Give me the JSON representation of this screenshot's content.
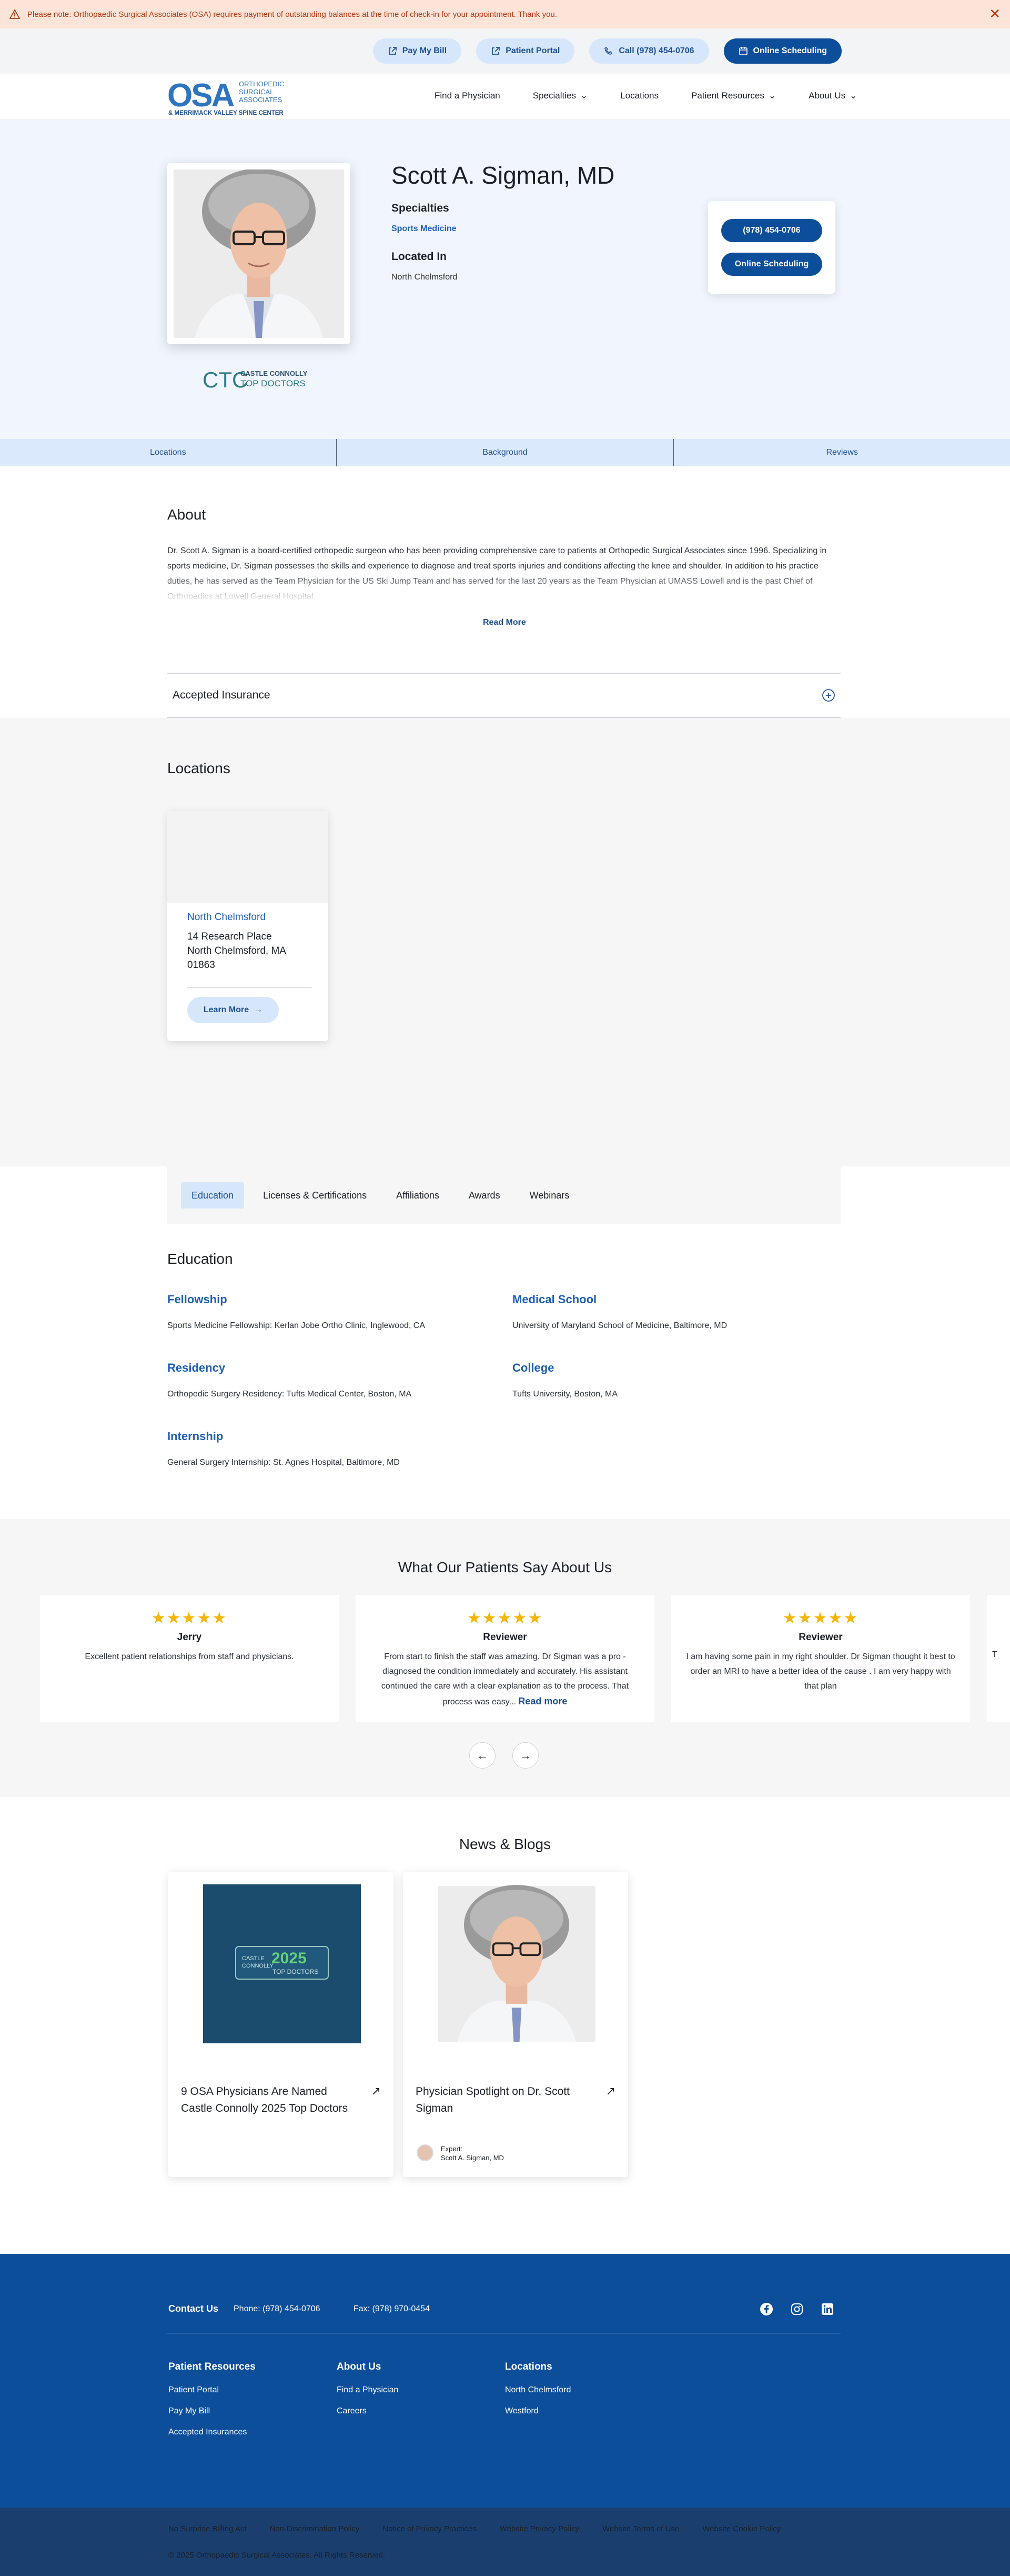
{
  "alert": {
    "text": "Please note: Orthopaedic Surgical Associates (OSA) requires payment of outstanding balances at the time of check-in for your appointment. Thank you.",
    "close_icon": "close-icon"
  },
  "utility": {
    "pay_bill": "Pay My Bill",
    "patient_portal": "Patient Portal",
    "call": "Call (978) 454-0706",
    "online_scheduling": "Online Scheduling"
  },
  "logo": {
    "mark": "OSA",
    "line1": "ORTHOPEDIC",
    "line2": "SURGICAL",
    "line3": "ASSOCIATES",
    "line4": "& MERRIMACK VALLEY SPINE CENTER"
  },
  "nav": {
    "find_physician": "Find a Physician",
    "specialties": "Specialties",
    "locations": "Locations",
    "patient_resources": "Patient Resources",
    "about_us": "About Us"
  },
  "profile": {
    "name": "Scott A. Sigman, MD",
    "specialties_label": "Specialties",
    "specialty": "Sports Medicine",
    "located_label": "Located In",
    "location": "North Chelmsford",
    "phone_btn": "(978) 454-0706",
    "scheduling_btn": "Online Scheduling",
    "badge_line1": "CASTLE CONNOLLY",
    "badge_line2": "TOP DOCTORS"
  },
  "section_tabs": [
    "Locations",
    "Background",
    "Reviews"
  ],
  "about": {
    "title": "About",
    "text": "Dr. Scott A. Sigman is a board-certified orthopedic surgeon who has been providing comprehensive care to patients at Orthopedic Surgical Associates since 1996. Specializing in sports medicine, Dr. Sigman possesses the skills and experience to diagnose and treat sports injuries and conditions affecting the knee and shoulder. In addition to his practice duties, he has served as the Team Physician for the US Ski Jump Team and has served for the last 20 years as the Team Physician at UMASS Lowell and is the past Chief of Orthopedics at Lowell General Hospital.",
    "read_more": "Read More",
    "insurance": "Accepted Insurance"
  },
  "locations": {
    "title": "Locations",
    "card": {
      "name": "North Chelmsford",
      "addr1": "14 Research Place",
      "addr2": "North Chelmsford, MA",
      "addr3": "01863",
      "learn_more": "Learn More"
    }
  },
  "education": {
    "tabs": [
      "Education",
      "Licenses & Certifications",
      "Affiliations",
      "Awards",
      "Webinars"
    ],
    "title": "Education",
    "fellowship_h": "Fellowship",
    "fellowship_v": "Sports Medicine Fellowship: Kerlan Jobe Ortho Clinic, Inglewood, CA",
    "medical_h": "Medical School",
    "medical_v": "University of Maryland School of Medicine, Baltimore, MD",
    "residency_h": "Residency",
    "residency_v": "Orthopedic Surgery Residency: Tufts Medical Center, Boston, MA",
    "college_h": "College",
    "college_v": "Tufts University, Boston, MA",
    "internship_h": "Internship",
    "internship_v": "General Surgery Internship: St. Agnes Hospital, Baltimore, MD"
  },
  "reviews": {
    "title": "What Our Patients Say About Us",
    "stars": "★★★★★",
    "rating": 5,
    "items": [
      {
        "name": "Jerry",
        "text": "Excellent patient relationships from staff and physicians."
      },
      {
        "name": "Reviewer",
        "text": "From start to finish the staff was amazing. Dr Sigman was a pro - diagnosed the condition immediately and accurately. His assistant continued the care with a clear explanation as to the process. That process was easy...",
        "more": "Read more"
      },
      {
        "name": "Reviewer",
        "text": "I am having some pain in my right shoulder. Dr Sigman thought it best to order an MRI to have a better idea of the cause . I am very happy with that plan"
      },
      {
        "name": "",
        "text": "T"
      }
    ],
    "prev": "←",
    "next": "→"
  },
  "news": {
    "title": "News & Blogs",
    "cards": [
      {
        "headline": "9 OSA Physicians Are Named Castle Connolly 2025 Top Doctors",
        "image_year": "2025",
        "image_text": "TOP DOCTORS",
        "image_brand1": "CASTLE",
        "image_brand2": "CONNOLLY"
      },
      {
        "headline": "Physician Spotlight on Dr. Scott Sigman",
        "expert_label": "Expert:",
        "expert_name": "Scott A. Sigman, MD"
      }
    ]
  },
  "footer": {
    "contact_label": "Contact Us",
    "phone": "Phone: (978) 454-0706",
    "fax": "Fax: (978) 970-0454",
    "col1_h": "Patient Resources",
    "col1": [
      "Patient Portal",
      "Pay My Bill",
      "Accepted Insurances"
    ],
    "col2_h": "About Us",
    "col2": [
      "Find a Physician",
      "Careers"
    ],
    "col3_h": "Locations",
    "col3": [
      "North Chelmsford",
      "Westford"
    ],
    "legal": [
      "No Surprise Billing Act",
      "Non-Discrimination Policy",
      "Notice of Privacy Practices",
      "Website Privacy Policy",
      "Website Terms of Use",
      "Website Cookie Policy"
    ],
    "copyright": "© 2025 Orthopaedic Surgical Associates. All Rights Reserved."
  },
  "colors": {
    "brand_blue": "#0d4e9a",
    "light_blue": "#d7e7fb",
    "link_blue": "#1d5fb0",
    "alert_bg": "#fde4d8",
    "star": "#f6b500"
  }
}
